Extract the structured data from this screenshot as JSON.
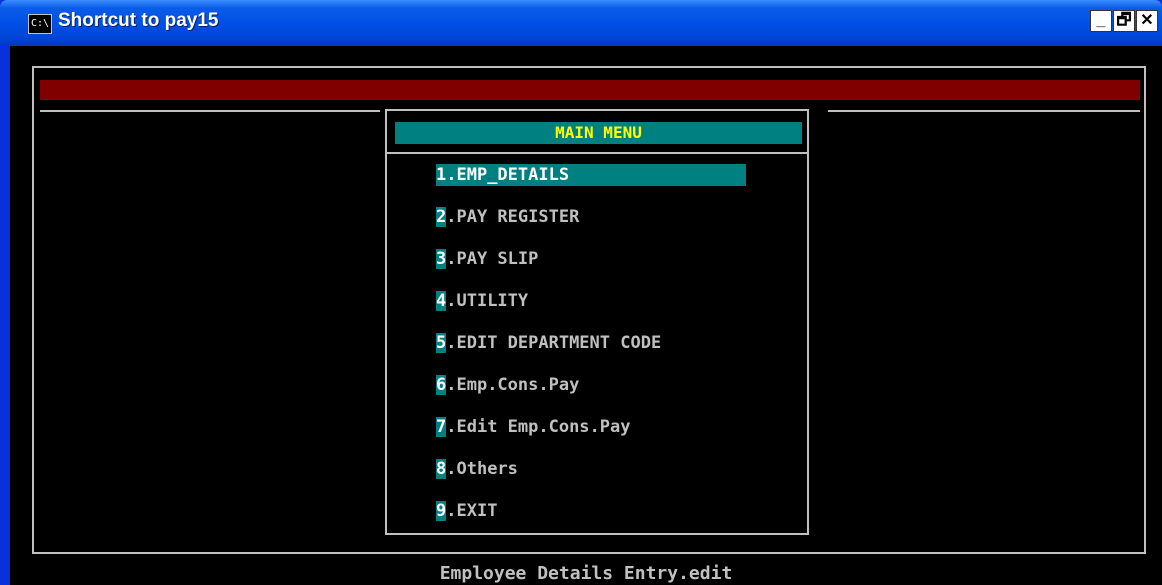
{
  "window": {
    "title": "Shortcut to pay15",
    "icon_text": "C:\\",
    "minimize_label": "_",
    "maximize_label": "🗗",
    "close_label": "✕"
  },
  "menu": {
    "title": "MAIN MENU",
    "items": [
      {
        "num": "1",
        "label": ".EMP_DETAILS",
        "selected": true
      },
      {
        "num": "2",
        "label": ".PAY REGISTER"
      },
      {
        "num": "3",
        "label": ".PAY SLIP"
      },
      {
        "num": "4",
        "label": ".UTILITY"
      },
      {
        "num": "5",
        "label": ".EDIT DEPARTMENT CODE"
      },
      {
        "num": "6",
        "label": ".Emp.Cons.Pay"
      },
      {
        "num": "7",
        "label": ".Edit Emp.Cons.Pay"
      },
      {
        "num": "8",
        "label": ".Others"
      },
      {
        "num": "9",
        "label": ".EXIT"
      }
    ]
  },
  "status": "Employee Details Entry.edit",
  "colors": {
    "title_bar": "#0054e3",
    "console_bg": "#000000",
    "header_bar": "#800000",
    "menu_accent": "#008080",
    "menu_title_text": "#ffff00",
    "text": "#c0c0c0"
  }
}
